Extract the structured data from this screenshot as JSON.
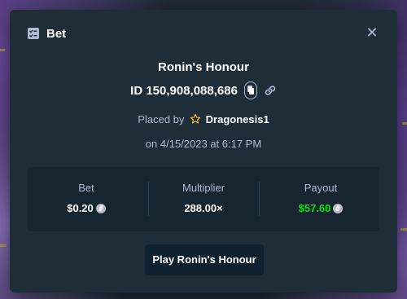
{
  "modal": {
    "title": "Bet",
    "close_symbol": "✕"
  },
  "bet": {
    "game_name": "Ronin's Honour",
    "id_text": "ID 150,908,088,686",
    "placed_by_prefix": "Placed by",
    "username": "Dragonesis1",
    "date_text": "on 4/15/2023 at 6:17 PM"
  },
  "stats": {
    "bet_label": "Bet",
    "bet_value": "$0.20",
    "multiplier_label": "Multiplier",
    "multiplier_value": "288.00×",
    "payout_label": "Payout",
    "payout_value": "$57.60"
  },
  "play_button": "Play Ronin's Honour",
  "icons": {
    "header": "bet-slip-icon",
    "copy": "copy-icon",
    "link": "link-icon",
    "user_badge": "star-icon",
    "currency": "litecoin-icon"
  },
  "colors": {
    "modal_bg": "#1e2d38",
    "stats_bg": "#172530",
    "payout_green": "#00e701",
    "muted_text": "#b1bad3"
  }
}
